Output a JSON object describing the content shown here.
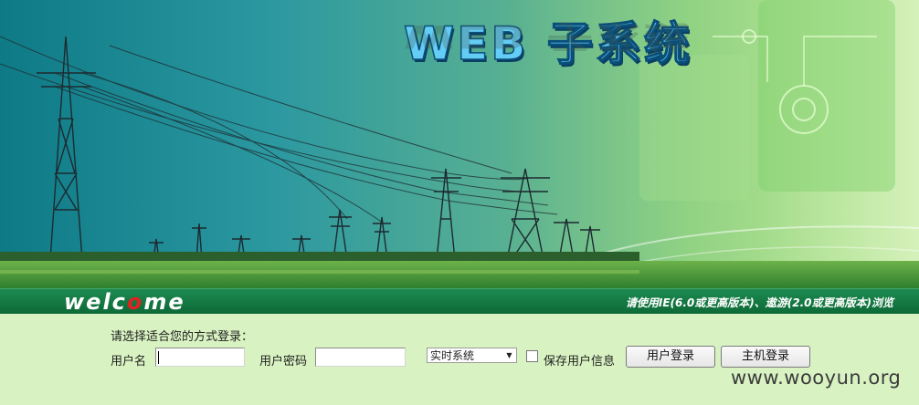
{
  "banner": {
    "title": "WEB 子系统",
    "colors": {
      "title_fill": "#64cdf6",
      "title_outline": "#0a4f7a",
      "sky_left": "#0e7a86",
      "sky_right": "#a8dc7a",
      "grass": "#3e9a3c"
    }
  },
  "strip": {
    "welcome_prefix": "welc",
    "welcome_o": "o",
    "welcome_suffix": "me",
    "browser_note": "请使用IE(6.0或更高版本)、遨游(2.0或更高版本)浏览"
  },
  "login": {
    "prompt": "请选择适合您的方式登录：",
    "username_label": "用户名",
    "username_value": "",
    "password_label": "用户密码",
    "password_value": "",
    "mode_selected": "实时系统",
    "save_label": "保存用户信息",
    "save_checked": false,
    "user_login_button": "用户登录",
    "host_login_button": "主机登录"
  },
  "watermark": "www.wooyun.org",
  "icons": {
    "dropdown": "chevron-down-icon"
  }
}
